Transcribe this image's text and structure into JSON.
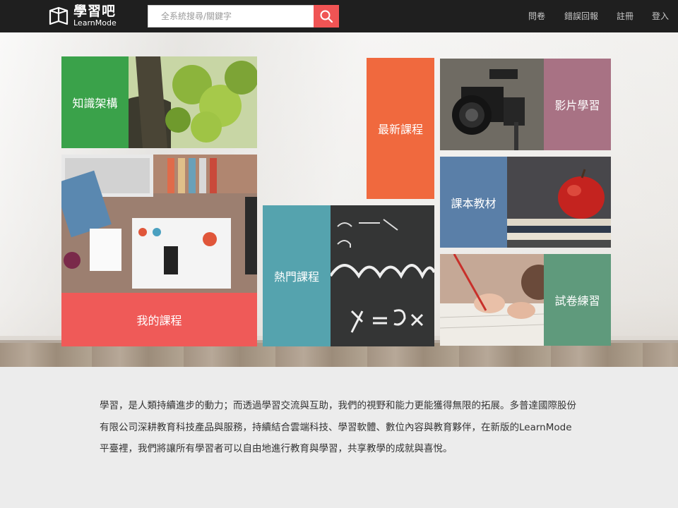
{
  "header": {
    "logo_zh": "學習吧",
    "logo_en": "LearnMode",
    "search_placeholder": "全系統搜尋/關鍵字",
    "nav": [
      "問卷",
      "錯誤回報",
      "註冊",
      "登入"
    ]
  },
  "tiles": {
    "knowledge": "知識架構",
    "my_courses": "我的課程",
    "latest": "最新課程",
    "popular": "熱門課程",
    "video": "影片學習",
    "textbook": "課本教材",
    "exam": "試卷練習"
  },
  "about": "學習，是人類持續進步的動力；而透過學習交流與互助，我們的視野和能力更能獲得無限的拓展。多普達國際股份有限公司深耕教育科技產品與服務，持續結合雲端科技、學習軟體、數位內容與教育夥伴，在新版的LearnMode平臺裡，我們將讓所有學習者可以自由地進行教育與學習，共享教學的成就與喜悅。",
  "colors": {
    "header_bg": "#1f1f1f",
    "search_button": "#f05454",
    "knowledge": "#3aa24a",
    "my_courses": "#ef5a58",
    "latest": "#f0693e",
    "popular": "#55a3ae",
    "video": "#a87284",
    "textbook": "#5a7fa8",
    "exam": "#5f9a7c"
  }
}
